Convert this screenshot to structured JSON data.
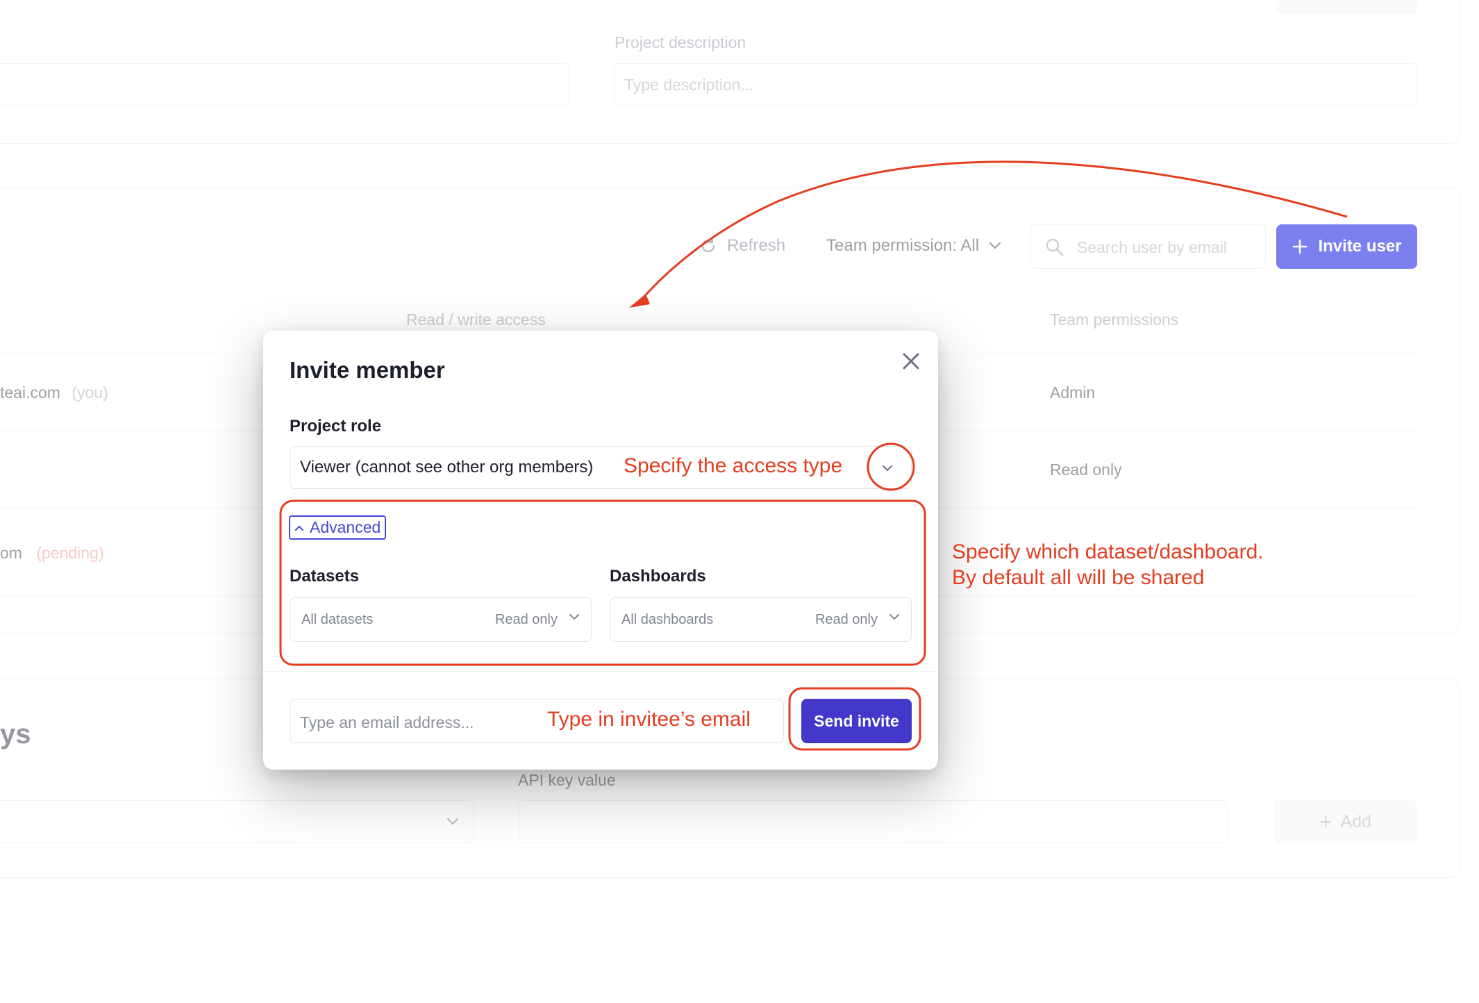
{
  "background": {
    "project_description_label": "Project description",
    "project_description_placeholder": "Type description...",
    "toolbar": {
      "refresh_label": "Refresh",
      "team_permission_filter": "Team permission: All",
      "search_placeholder": "Search user by email",
      "invite_user_label": "Invite user"
    },
    "table": {
      "col_access": "Read / write access",
      "col_team_permissions": "Team permissions",
      "rows": [
        {
          "email_fragment": "teai.com",
          "tag": "(you)",
          "permission": "Admin"
        },
        {
          "email_fragment": "",
          "tag": "",
          "permission": "Read only"
        },
        {
          "email_fragment": "om",
          "tag": "(pending)",
          "permission": ""
        }
      ]
    },
    "api_section": {
      "heading_fragment": "ys",
      "api_key_value_label": "API key value",
      "add_label": "Add"
    }
  },
  "modal": {
    "title": "Invite member",
    "project_role_label": "Project role",
    "project_role_value": "Viewer (cannot see other org members)",
    "advanced_label": "Advanced",
    "datasets_label": "Datasets",
    "datasets_placeholder": "All datasets",
    "datasets_permission": "Read only",
    "dashboards_label": "Dashboards",
    "dashboards_placeholder": "All dashboards",
    "dashboards_permission": "Read only",
    "email_placeholder": "Type an email address...",
    "send_invite_label": "Send invite"
  },
  "annotations": {
    "access_type": "Specify the access type",
    "dataset_line1": "Specify which dataset/dashboard.",
    "dataset_line2": "By default all will be shared",
    "email": "Type in invitee’s email",
    "color": "#e43d1f"
  },
  "colors": {
    "primary": "#4338ca",
    "invite_button": "#7b7ff0",
    "pending_tag": "#e88a8a"
  }
}
